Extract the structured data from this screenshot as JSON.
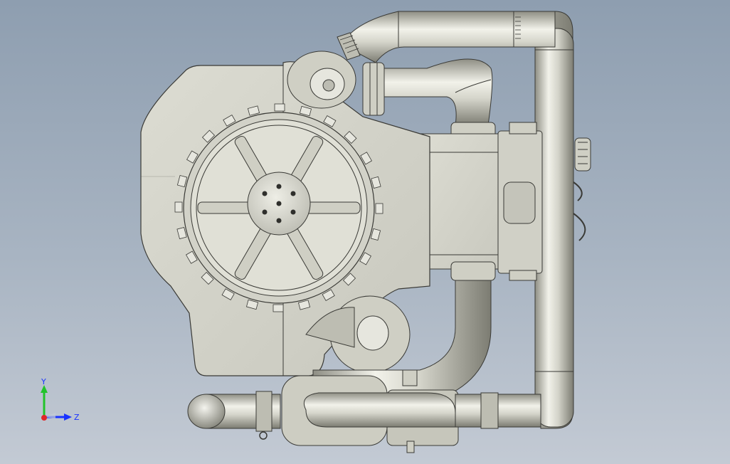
{
  "viewport": {
    "background_top": "#8e9eb0",
    "background_bottom": "#c3cad4"
  },
  "model": {
    "part_color": "#d6d6cc",
    "edge_color": "#3a3a36",
    "pipe_color": "#cfcfc4"
  },
  "triad": {
    "y_label": "Y",
    "z_label": "Z",
    "y_color": "#22c32a",
    "z_color": "#1a33ff",
    "x_color": "#e0262a"
  }
}
